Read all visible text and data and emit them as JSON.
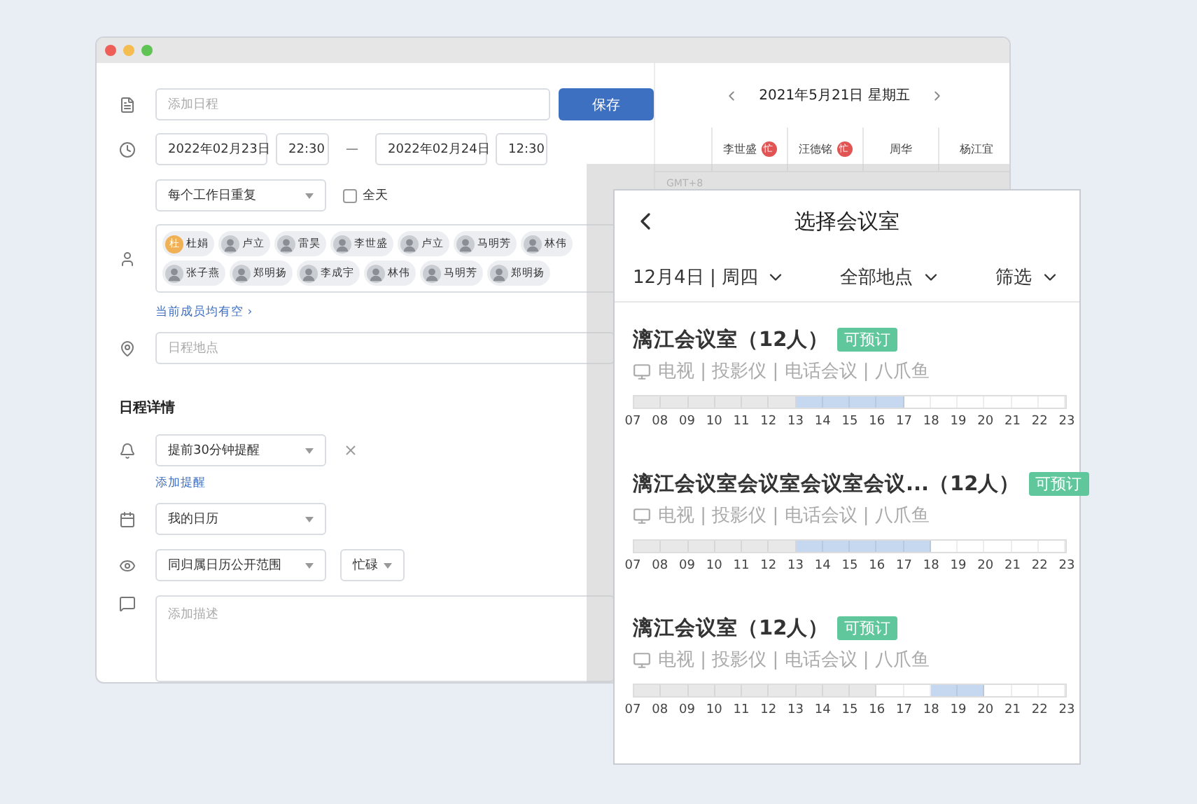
{
  "form": {
    "title_field": {
      "placeholder": "添加日程"
    },
    "save_button": "保存",
    "start_date": "2022年02月23日",
    "start_time": "22:30",
    "separator": "—",
    "end_date": "2022年02月24日",
    "end_time": "12:30",
    "repeat": "每个工作日重复",
    "all_day": {
      "label": "全天",
      "checked": false
    },
    "attendees": [
      {
        "name": "杜娟",
        "avatar": {
          "kind": "initial",
          "text": "杜"
        }
      },
      {
        "name": "卢立",
        "avatar": {
          "kind": "photo"
        }
      },
      {
        "name": "雷昊",
        "avatar": {
          "kind": "photo"
        }
      },
      {
        "name": "李世盛",
        "avatar": {
          "kind": "photo"
        }
      },
      {
        "name": "卢立",
        "avatar": {
          "kind": "photo"
        }
      },
      {
        "name": "马明芳",
        "avatar": {
          "kind": "photo"
        }
      },
      {
        "name": "林伟",
        "avatar": {
          "kind": "photo"
        }
      },
      {
        "name": "张子燕",
        "avatar": {
          "kind": "photo"
        }
      },
      {
        "name": "郑明扬",
        "avatar": {
          "kind": "photo"
        }
      },
      {
        "name": "李成宇",
        "avatar": {
          "kind": "photo"
        }
      },
      {
        "name": "林伟",
        "avatar": {
          "kind": "photo"
        }
      },
      {
        "name": "马明芳",
        "avatar": {
          "kind": "photo"
        }
      },
      {
        "name": "郑明扬",
        "avatar": {
          "kind": "photo"
        }
      }
    ],
    "availability_link": "当前成员均有空 ›",
    "location_field": {
      "placeholder": "日程地点"
    },
    "details_heading": "日程详情",
    "reminder": "提前30分钟提醒",
    "add_reminder_link": "添加提醒",
    "calendar": "我的日历",
    "visibility": "同归属日历公开范围",
    "busy_status": "忙碌",
    "description_field": {
      "placeholder": "添加描述"
    }
  },
  "calendar": {
    "date": "2021年5月21日 星期五",
    "timezone": "GMT+8",
    "people": [
      {
        "name": "李世盛",
        "badge": "忙"
      },
      {
        "name": "汪德铭",
        "badge": "忙"
      },
      {
        "name": "周华"
      },
      {
        "name": "杨江宜"
      }
    ]
  },
  "room_picker": {
    "title": "选择会议室",
    "filters": [
      "12月4日 | 周四",
      "全部地点",
      "筛选"
    ],
    "rooms": [
      {
        "name": "漓江会议室（12人）",
        "status": "可预订",
        "equipment": "电视 | 投影仪 | 电话会议 | 八爪鱼",
        "hours": [
          "07",
          "08",
          "09",
          "10",
          "11",
          "12",
          "13",
          "14",
          "15",
          "16",
          "17",
          "18",
          "19",
          "20",
          "21",
          "22",
          "23"
        ],
        "slots": [
          {
            "kind": "past"
          },
          {
            "kind": "past"
          },
          {
            "kind": "past"
          },
          {
            "kind": "past"
          },
          {
            "kind": "past"
          },
          {
            "kind": "past"
          },
          {
            "kind": "booked"
          },
          {
            "kind": "booked"
          },
          {
            "kind": "booked"
          },
          {
            "kind": "booked"
          },
          {
            "kind": "free"
          },
          {
            "kind": "free"
          },
          {
            "kind": "free"
          },
          {
            "kind": "free"
          },
          {
            "kind": "free"
          },
          {
            "kind": "free"
          }
        ]
      },
      {
        "name": "漓江会议室会议室会议室会议...（12人）",
        "status": "可预订",
        "equipment": "电视 | 投影仪 | 电话会议 | 八爪鱼",
        "hours": [
          "07",
          "08",
          "09",
          "10",
          "11",
          "12",
          "13",
          "14",
          "15",
          "16",
          "17",
          "18",
          "19",
          "20",
          "21",
          "22",
          "23"
        ],
        "slots": [
          {
            "kind": "past"
          },
          {
            "kind": "past"
          },
          {
            "kind": "past"
          },
          {
            "kind": "past"
          },
          {
            "kind": "past"
          },
          {
            "kind": "past"
          },
          {
            "kind": "booked"
          },
          {
            "kind": "booked"
          },
          {
            "kind": "booked"
          },
          {
            "kind": "booked"
          },
          {
            "kind": "booked"
          },
          {
            "kind": "free"
          },
          {
            "kind": "free"
          },
          {
            "kind": "free"
          },
          {
            "kind": "free"
          },
          {
            "kind": "free"
          }
        ]
      },
      {
        "name": "漓江会议室（12人）",
        "status": "可预订",
        "equipment": "电视 | 投影仪 | 电话会议 | 八爪鱼",
        "hours": [
          "07",
          "08",
          "09",
          "10",
          "11",
          "12",
          "13",
          "14",
          "15",
          "16",
          "17",
          "18",
          "19",
          "20",
          "21",
          "22",
          "23"
        ],
        "slots": [
          {
            "kind": "past"
          },
          {
            "kind": "past"
          },
          {
            "kind": "past"
          },
          {
            "kind": "past"
          },
          {
            "kind": "past"
          },
          {
            "kind": "past"
          },
          {
            "kind": "past"
          },
          {
            "kind": "past"
          },
          {
            "kind": "past"
          },
          {
            "kind": "free"
          },
          {
            "kind": "free"
          },
          {
            "kind": "booked"
          },
          {
            "kind": "booked"
          },
          {
            "kind": "free"
          },
          {
            "kind": "free"
          },
          {
            "kind": "free"
          }
        ]
      }
    ]
  }
}
